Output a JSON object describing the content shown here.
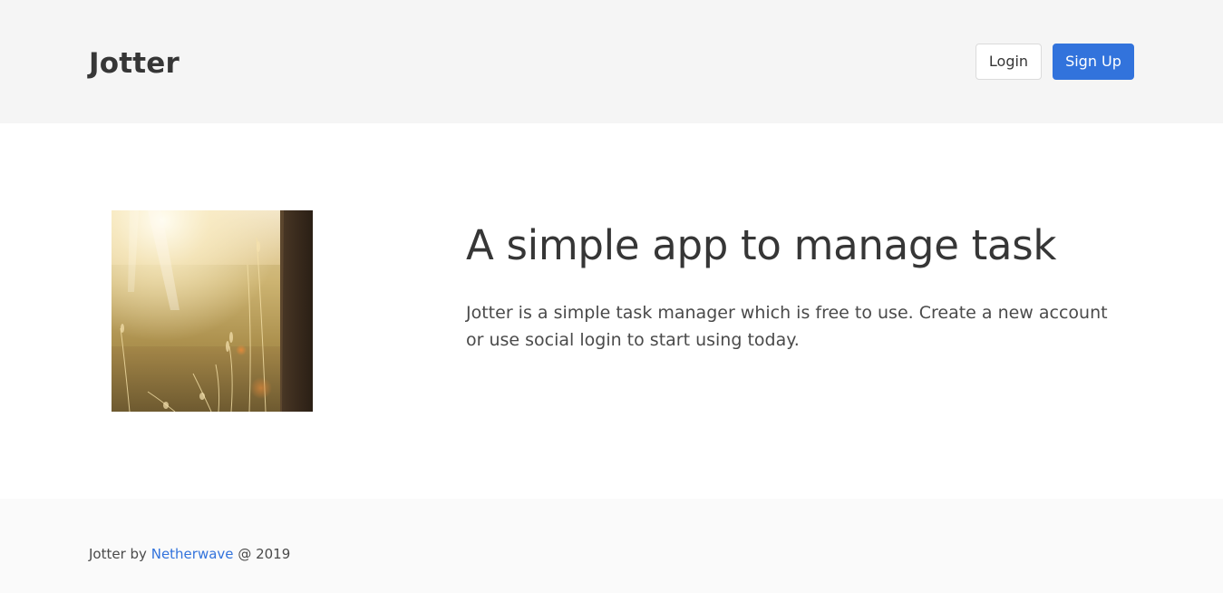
{
  "header": {
    "brand": "Jotter",
    "login_label": "Login",
    "signup_label": "Sign Up"
  },
  "hero": {
    "title": "A simple app to manage task",
    "subtitle": "Jotter is a simple task manager which is free to use. Create a new account or use social login to start using today.",
    "image": "sunlit-grass-photo"
  },
  "footer": {
    "prefix": "Jotter by",
    "author_link": "Netherwave",
    "suffix": "@ 2019"
  },
  "colors": {
    "primary": "#3273dc",
    "header_bg": "#f5f5f5",
    "footer_bg": "#fafafa",
    "text": "#4a4a4a"
  }
}
